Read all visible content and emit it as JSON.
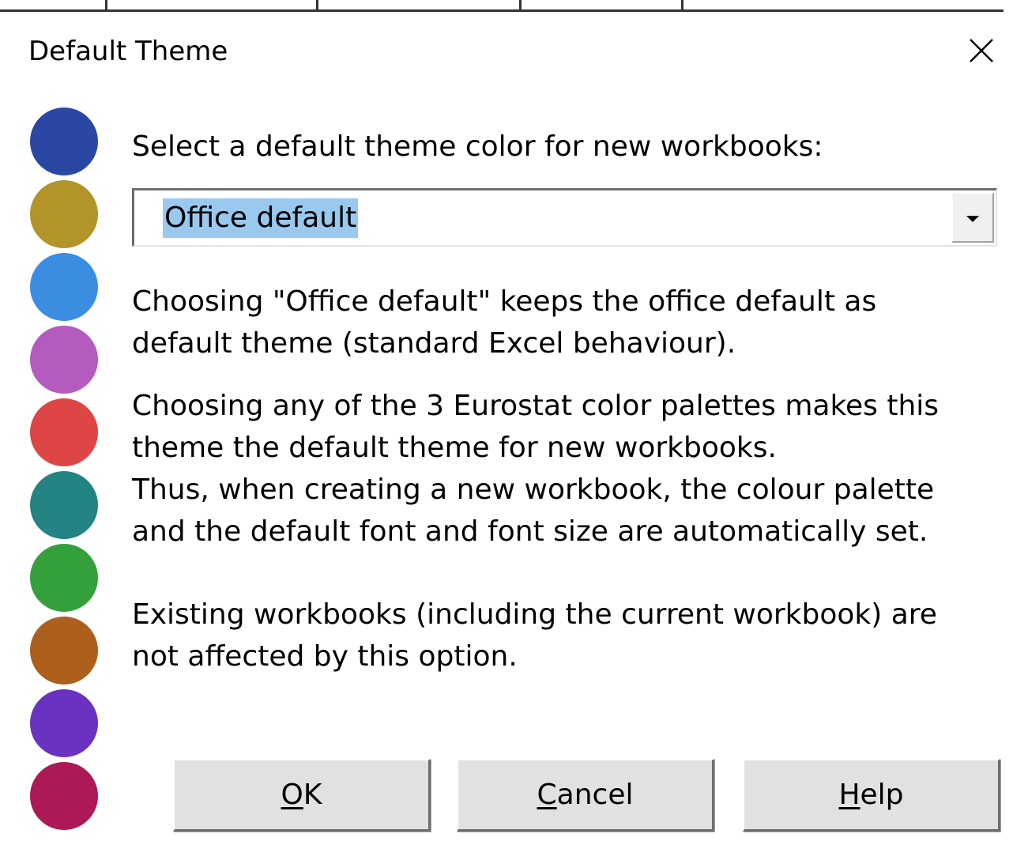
{
  "dialog": {
    "title": "Default Theme",
    "prompt": "Select a default theme color for new workbooks:",
    "theme_select": {
      "selected": "Office default"
    },
    "paragraphs": [
      "Choosing \"Office default\" keeps the office default as\ndefault theme (standard Excel behaviour).",
      "Choosing any of the 3 Eurostat color palettes makes this\ntheme the default theme for new workbooks.\nThus, when creating a new workbook, the colour palette\nand the default font and font size are automatically set.",
      "Existing workbooks (including the current workbook) are\nnot affected by this option."
    ],
    "buttons": {
      "ok": {
        "mnemonic": "O",
        "rest": "K"
      },
      "cancel": {
        "mnemonic": "C",
        "rest": "ancel"
      },
      "help": {
        "mnemonic": "H",
        "rest": "elp"
      }
    },
    "close_icon": "close-icon"
  },
  "palette_swatches": [
    {
      "name": "dark-blue",
      "color": "#2a48a3"
    },
    {
      "name": "olive-gold",
      "color": "#b39429"
    },
    {
      "name": "light-blue",
      "color": "#3b8de2"
    },
    {
      "name": "orchid",
      "color": "#b55abf"
    },
    {
      "name": "red",
      "color": "#de4545"
    },
    {
      "name": "teal",
      "color": "#248383"
    },
    {
      "name": "green",
      "color": "#34a03b"
    },
    {
      "name": "brown",
      "color": "#ad5f1e"
    },
    {
      "name": "purple",
      "color": "#6a32c1"
    },
    {
      "name": "crimson",
      "color": "#ad1957"
    }
  ],
  "colors": {
    "selection_highlight": "#99c9ef",
    "button_face": "#e1e1e1"
  }
}
